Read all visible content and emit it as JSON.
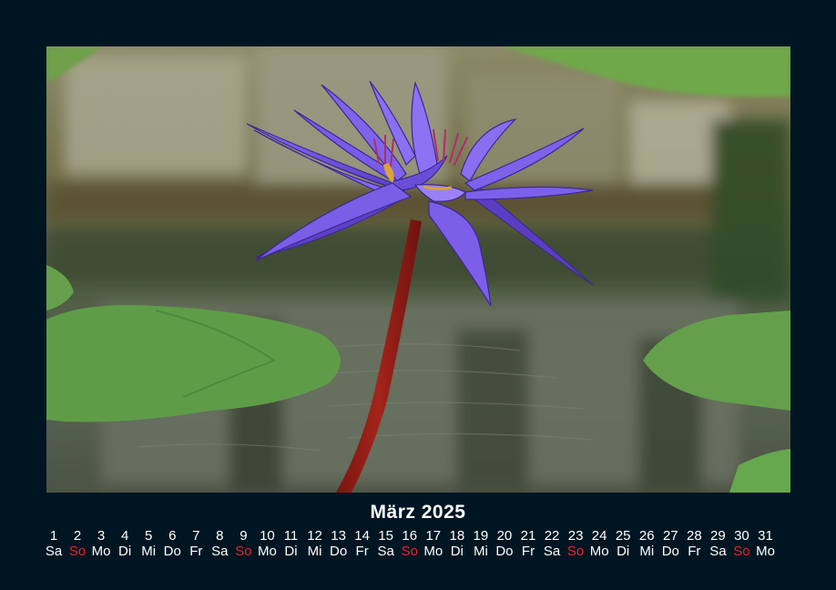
{
  "calendar": {
    "title": "März 2025",
    "colors": {
      "background": "#001522",
      "text": "#ffffff",
      "sunday": "#e8262a"
    },
    "days": [
      {
        "day": "1",
        "weekday": "Sa"
      },
      {
        "day": "2",
        "weekday": "So"
      },
      {
        "day": "3",
        "weekday": "Mo"
      },
      {
        "day": "4",
        "weekday": "Di"
      },
      {
        "day": "5",
        "weekday": "Mi"
      },
      {
        "day": "6",
        "weekday": "Do"
      },
      {
        "day": "7",
        "weekday": "Fr"
      },
      {
        "day": "8",
        "weekday": "Sa"
      },
      {
        "day": "9",
        "weekday": "So"
      },
      {
        "day": "10",
        "weekday": "Mo"
      },
      {
        "day": "11",
        "weekday": "Di"
      },
      {
        "day": "12",
        "weekday": "Mi"
      },
      {
        "day": "13",
        "weekday": "Do"
      },
      {
        "day": "14",
        "weekday": "Fr"
      },
      {
        "day": "15",
        "weekday": "Sa"
      },
      {
        "day": "16",
        "weekday": "So"
      },
      {
        "day": "17",
        "weekday": "Mo"
      },
      {
        "day": "18",
        "weekday": "Di"
      },
      {
        "day": "19",
        "weekday": "Mi"
      },
      {
        "day": "20",
        "weekday": "Do"
      },
      {
        "day": "21",
        "weekday": "Fr"
      },
      {
        "day": "22",
        "weekday": "Sa"
      },
      {
        "day": "23",
        "weekday": "So"
      },
      {
        "day": "24",
        "weekday": "Mo"
      },
      {
        "day": "25",
        "weekday": "Di"
      },
      {
        "day": "26",
        "weekday": "Mi"
      },
      {
        "day": "27",
        "weekday": "Do"
      },
      {
        "day": "28",
        "weekday": "Fr"
      },
      {
        "day": "29",
        "weekday": "Sa"
      },
      {
        "day": "30",
        "weekday": "So"
      },
      {
        "day": "31",
        "weekday": "Mo"
      }
    ]
  }
}
